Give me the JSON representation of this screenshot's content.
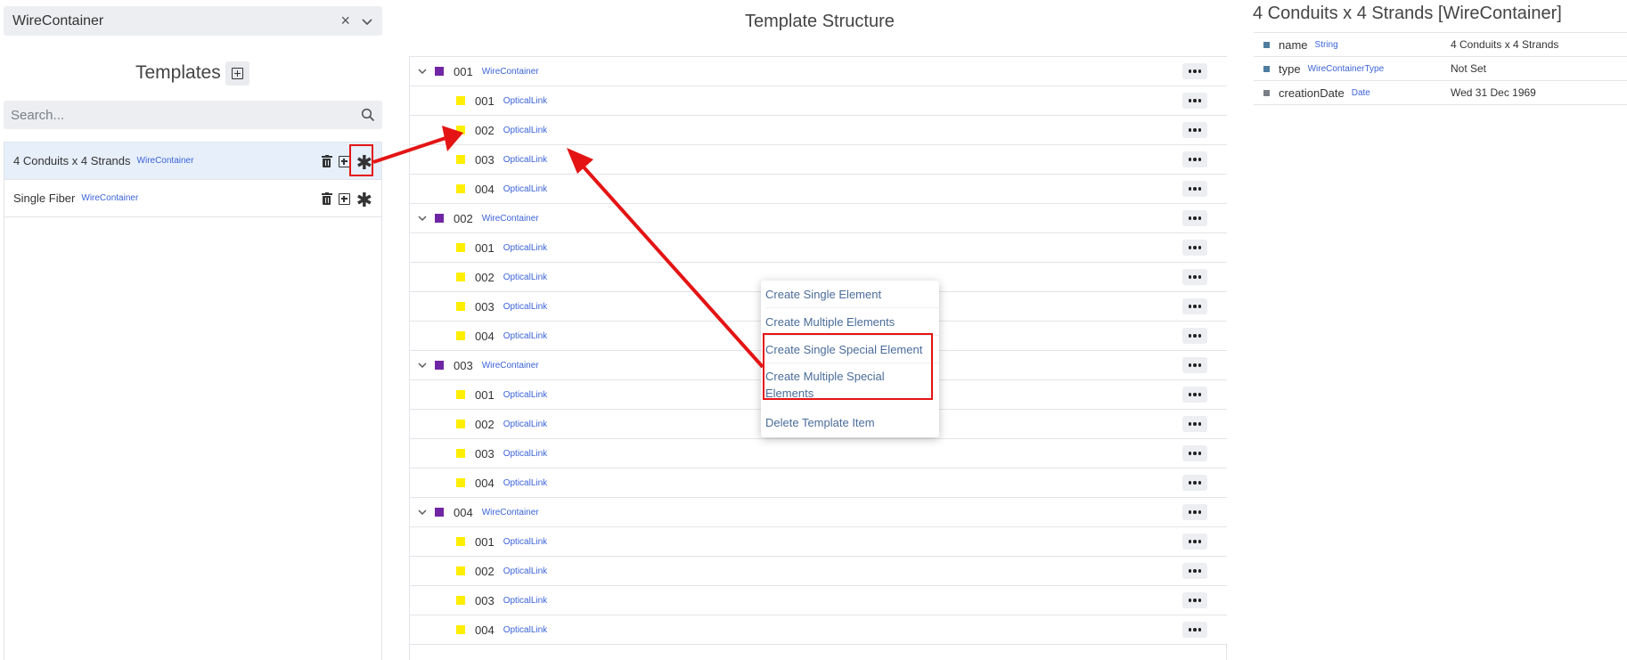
{
  "class_select": {
    "value": "WireContainer"
  },
  "templates": {
    "title": "Templates",
    "search_placeholder": "Search...",
    "items": [
      {
        "name": "4 Conduits x 4 Strands",
        "type": "WireContainer"
      },
      {
        "name": "Single Fiber",
        "type": "WireContainer"
      }
    ]
  },
  "structure": {
    "title": "Template Structure",
    "groups": [
      {
        "code": "001",
        "type": "WireContainer",
        "children": [
          {
            "code": "001",
            "type": "OpticalLink"
          },
          {
            "code": "002",
            "type": "OpticalLink"
          },
          {
            "code": "003",
            "type": "OpticalLink"
          },
          {
            "code": "004",
            "type": "OpticalLink"
          }
        ]
      },
      {
        "code": "002",
        "type": "WireContainer",
        "children": [
          {
            "code": "001",
            "type": "OpticalLink"
          },
          {
            "code": "002",
            "type": "OpticalLink"
          },
          {
            "code": "003",
            "type": "OpticalLink"
          },
          {
            "code": "004",
            "type": "OpticalLink"
          }
        ]
      },
      {
        "code": "003",
        "type": "WireContainer",
        "children": [
          {
            "code": "001",
            "type": "OpticalLink"
          },
          {
            "code": "002",
            "type": "OpticalLink"
          },
          {
            "code": "003",
            "type": "OpticalLink"
          },
          {
            "code": "004",
            "type": "OpticalLink"
          }
        ]
      },
      {
        "code": "004",
        "type": "WireContainer",
        "children": [
          {
            "code": "001",
            "type": "OpticalLink"
          },
          {
            "code": "002",
            "type": "OpticalLink"
          },
          {
            "code": "003",
            "type": "OpticalLink"
          },
          {
            "code": "004",
            "type": "OpticalLink"
          }
        ]
      }
    ]
  },
  "context_menu": {
    "items": [
      "Create Single Element",
      "Create Multiple Elements",
      "Create Single Special Element",
      "Create Multiple Special Elements",
      "Delete Template Item"
    ]
  },
  "details": {
    "title": "4 Conduits x 4 Strands [WireContainer]",
    "props": [
      {
        "name": "name",
        "type": "String",
        "value": "4 Conduits x 4 Strands"
      },
      {
        "name": "type",
        "type": "WireContainerType",
        "value": "Not Set"
      },
      {
        "name": "creationDate",
        "type": "Date",
        "value": "Wed 31 Dec 1969"
      }
    ]
  },
  "colors": {
    "container_marker": "#7026a4",
    "link_marker": "#ffee00",
    "annotation": "#e41414",
    "menu_text": "#4a6c99",
    "type_tag": "#3b63d8"
  }
}
